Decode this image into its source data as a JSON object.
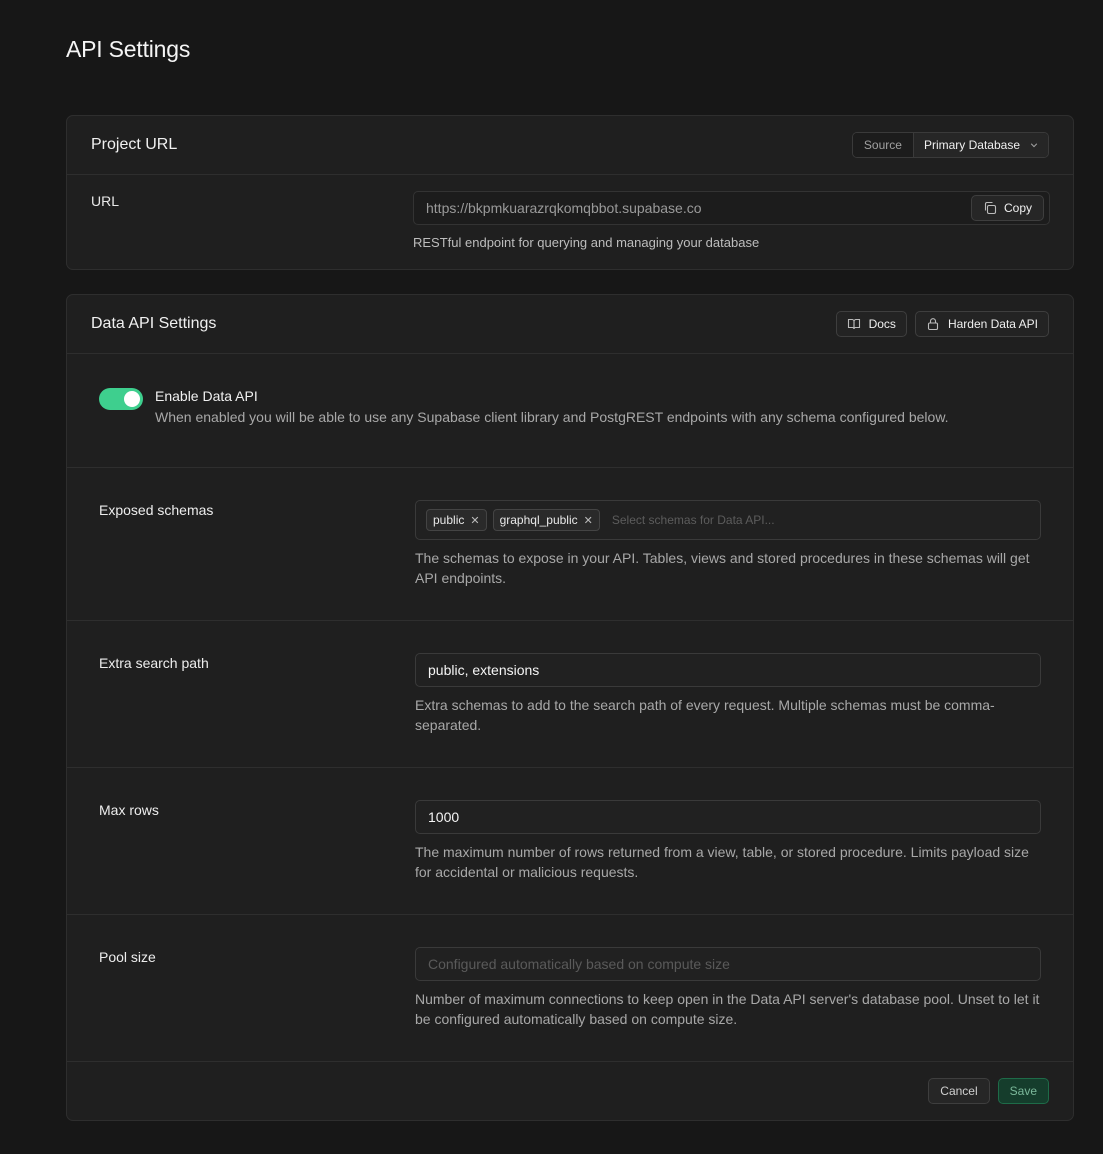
{
  "page": {
    "title": "API Settings"
  },
  "project_url": {
    "title": "Project URL",
    "source_label": "Source",
    "source_value": "Primary Database",
    "url_label": "URL",
    "url_value": "https://bkpmkuarazrqkomqbbot.supabase.co",
    "copy_label": "Copy",
    "url_help": "RESTful endpoint for querying and managing your database"
  },
  "data_api": {
    "title": "Data API Settings",
    "docs_label": "Docs",
    "harden_label": "Harden Data API",
    "enable": {
      "label": "Enable Data API",
      "description": "When enabled you will be able to use any Supabase client library and PostgREST endpoints with any schema configured below.",
      "enabled": true
    },
    "exposed_schemas": {
      "label": "Exposed schemas",
      "tags": [
        "public",
        "graphql_public"
      ],
      "placeholder": "Select schemas for Data API...",
      "help": "The schemas to expose in your API. Tables, views and stored procedures in these schemas will get API endpoints."
    },
    "extra_search_path": {
      "label": "Extra search path",
      "value": "public, extensions",
      "help": "Extra schemas to add to the search path of every request. Multiple schemas must be comma-separated."
    },
    "max_rows": {
      "label": "Max rows",
      "value": "1000",
      "help": "The maximum number of rows returned from a view, table, or stored procedure. Limits payload size for accidental or malicious requests."
    },
    "pool_size": {
      "label": "Pool size",
      "placeholder": "Configured automatically based on compute size",
      "help": "Number of maximum connections to keep open in the Data API server's database pool. Unset to let it be configured automatically based on compute size."
    },
    "cancel_label": "Cancel",
    "save_label": "Save"
  },
  "colors": {
    "accent": "#3ecf8e",
    "background": "#171717",
    "card": "#1f1f1f"
  }
}
